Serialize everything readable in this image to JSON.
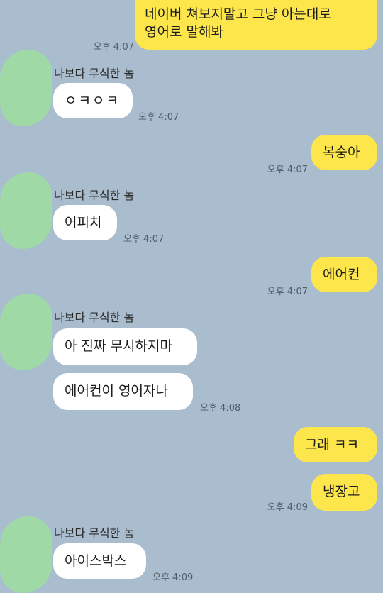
{
  "messages": [
    {
      "side": "out",
      "text": "네이버 쳐보지말고 그냥 아는대로\n영어로 말해봐",
      "time": "오후 4:07"
    },
    {
      "side": "in",
      "sender": "나보다 무식한 놈",
      "text": "ㅇㅋㅇㅋ",
      "time": "오후 4:07"
    },
    {
      "side": "out",
      "text": "복숭아",
      "time": "오후 4:07"
    },
    {
      "side": "in",
      "sender": "나보다 무식한 놈",
      "text": "어피치",
      "time": "오후 4:07"
    },
    {
      "side": "out",
      "text": "에어컨",
      "time": "오후 4:07"
    },
    {
      "side": "in",
      "sender": "나보다 무식한 놈",
      "text": "아 진짜 무시하지마"
    },
    {
      "side": "in",
      "text": "에어컨이 영어자나",
      "time": "오후 4:08"
    },
    {
      "side": "out",
      "text": "그래 ㅋㅋ"
    },
    {
      "side": "out",
      "text": "냉장고",
      "time": "오후 4:09"
    },
    {
      "side": "in",
      "sender": "나보다 무식한 놈",
      "text": "아이스박스",
      "time": "오후 4:09"
    }
  ],
  "colors": {
    "background": "#a9bdce",
    "outgoing": "#fde64b",
    "incoming": "#ffffff",
    "avatar": "#9fd9a6"
  }
}
